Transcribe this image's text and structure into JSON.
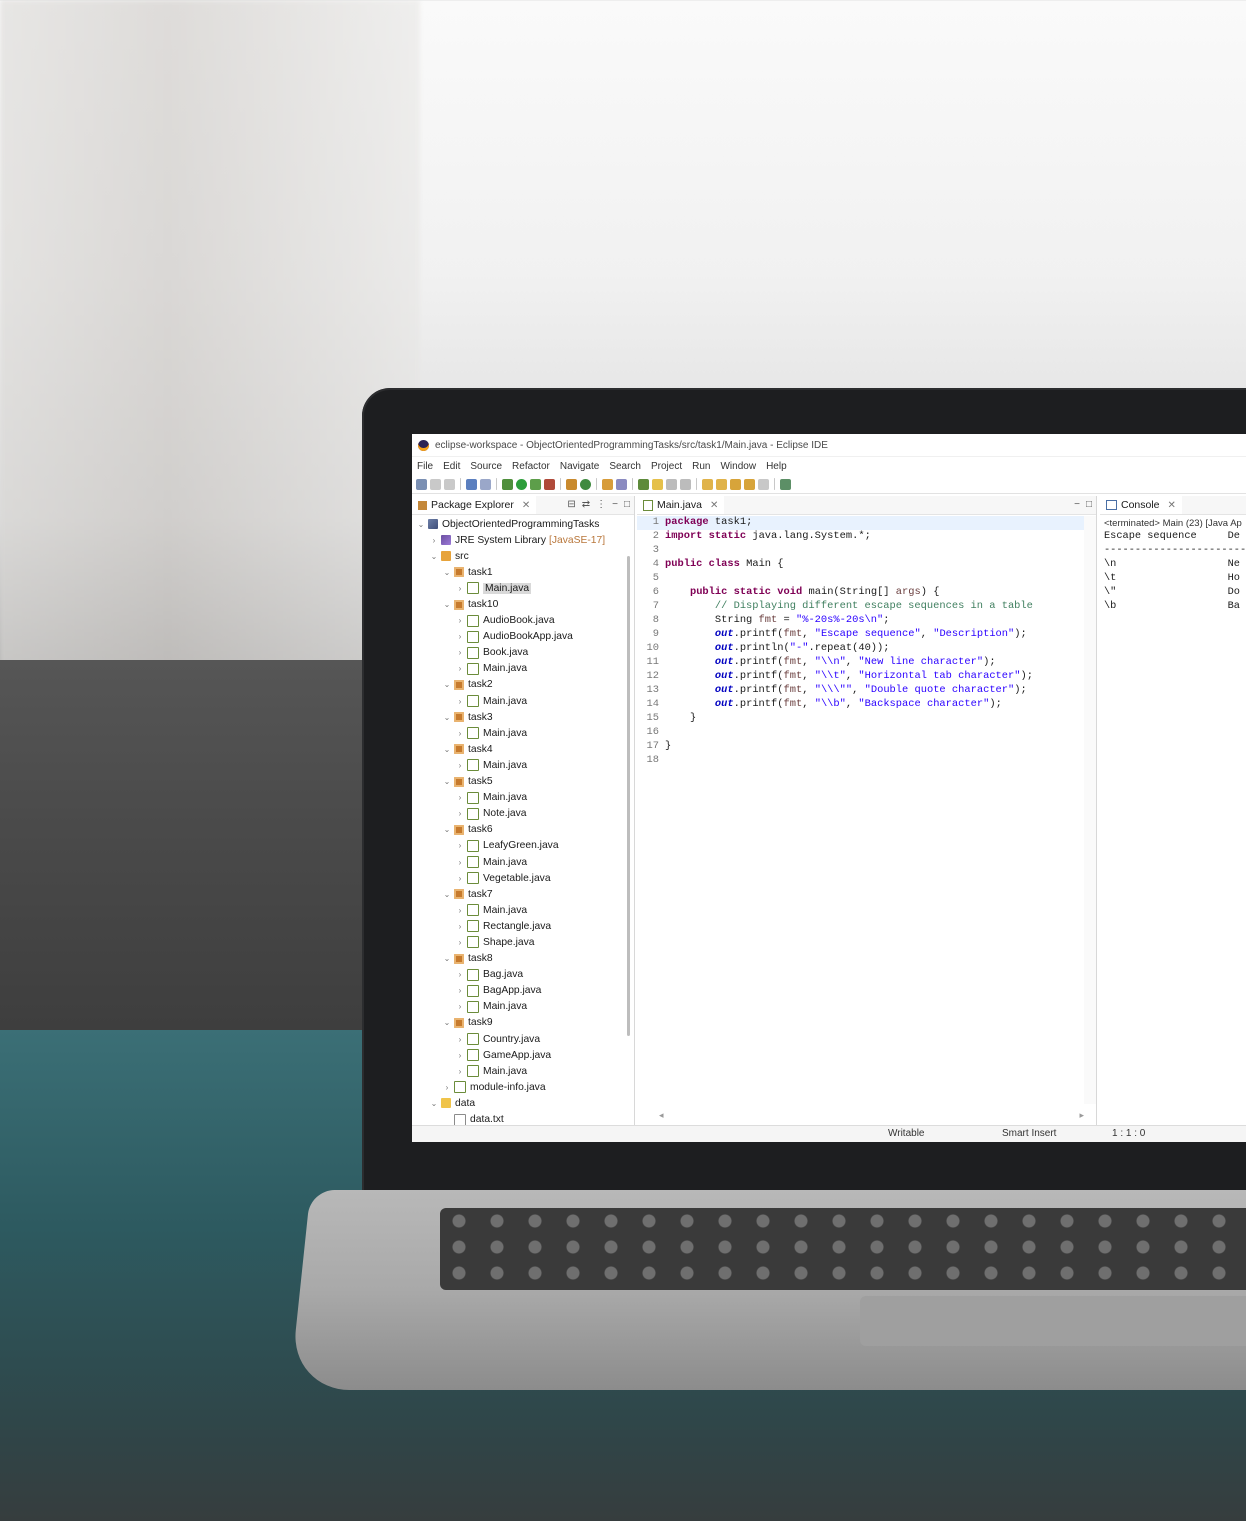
{
  "window": {
    "title": "eclipse-workspace - ObjectOrientedProgrammingTasks/src/task1/Main.java - Eclipse IDE"
  },
  "menu": [
    "File",
    "Edit",
    "Source",
    "Refactor",
    "Navigate",
    "Search",
    "Project",
    "Run",
    "Window",
    "Help"
  ],
  "explorer": {
    "tab_label": "Package Explorer",
    "tree": [
      {
        "depth": 0,
        "twisty": "v",
        "icon": "project",
        "label": "ObjectOrientedProgrammingTasks"
      },
      {
        "depth": 1,
        "twisty": ">",
        "icon": "library",
        "label": "JRE System Library",
        "tag": "[JavaSE-17]"
      },
      {
        "depth": 1,
        "twisty": "v",
        "icon": "source-folder",
        "label": "src"
      },
      {
        "depth": 2,
        "twisty": "v",
        "icon": "package",
        "label": "task1"
      },
      {
        "depth": 3,
        "twisty": ">",
        "icon": "java-file",
        "label": "Main.java",
        "selected": true
      },
      {
        "depth": 2,
        "twisty": "v",
        "icon": "package",
        "label": "task10"
      },
      {
        "depth": 3,
        "twisty": ">",
        "icon": "java-file",
        "label": "AudioBook.java"
      },
      {
        "depth": 3,
        "twisty": ">",
        "icon": "java-file",
        "label": "AudioBookApp.java"
      },
      {
        "depth": 3,
        "twisty": ">",
        "icon": "java-file",
        "label": "Book.java"
      },
      {
        "depth": 3,
        "twisty": ">",
        "icon": "java-file",
        "label": "Main.java"
      },
      {
        "depth": 2,
        "twisty": "v",
        "icon": "package",
        "label": "task2"
      },
      {
        "depth": 3,
        "twisty": ">",
        "icon": "java-file",
        "label": "Main.java"
      },
      {
        "depth": 2,
        "twisty": "v",
        "icon": "package",
        "label": "task3"
      },
      {
        "depth": 3,
        "twisty": ">",
        "icon": "java-file",
        "label": "Main.java"
      },
      {
        "depth": 2,
        "twisty": "v",
        "icon": "package",
        "label": "task4"
      },
      {
        "depth": 3,
        "twisty": ">",
        "icon": "java-file",
        "label": "Main.java"
      },
      {
        "depth": 2,
        "twisty": "v",
        "icon": "package",
        "label": "task5"
      },
      {
        "depth": 3,
        "twisty": ">",
        "icon": "java-file",
        "label": "Main.java"
      },
      {
        "depth": 3,
        "twisty": ">",
        "icon": "java-file",
        "label": "Note.java"
      },
      {
        "depth": 2,
        "twisty": "v",
        "icon": "package",
        "label": "task6"
      },
      {
        "depth": 3,
        "twisty": ">",
        "icon": "java-file",
        "label": "LeafyGreen.java"
      },
      {
        "depth": 3,
        "twisty": ">",
        "icon": "java-file",
        "label": "Main.java"
      },
      {
        "depth": 3,
        "twisty": ">",
        "icon": "java-file",
        "label": "Vegetable.java"
      },
      {
        "depth": 2,
        "twisty": "v",
        "icon": "package",
        "label": "task7"
      },
      {
        "depth": 3,
        "twisty": ">",
        "icon": "java-file",
        "label": "Main.java"
      },
      {
        "depth": 3,
        "twisty": ">",
        "icon": "java-file",
        "label": "Rectangle.java"
      },
      {
        "depth": 3,
        "twisty": ">",
        "icon": "java-file",
        "label": "Shape.java"
      },
      {
        "depth": 2,
        "twisty": "v",
        "icon": "package",
        "label": "task8"
      },
      {
        "depth": 3,
        "twisty": ">",
        "icon": "java-file",
        "label": "Bag.java"
      },
      {
        "depth": 3,
        "twisty": ">",
        "icon": "java-file",
        "label": "BagApp.java"
      },
      {
        "depth": 3,
        "twisty": ">",
        "icon": "java-file",
        "label": "Main.java"
      },
      {
        "depth": 2,
        "twisty": "v",
        "icon": "package",
        "label": "task9"
      },
      {
        "depth": 3,
        "twisty": ">",
        "icon": "java-file",
        "label": "Country.java"
      },
      {
        "depth": 3,
        "twisty": ">",
        "icon": "java-file",
        "label": "GameApp.java"
      },
      {
        "depth": 3,
        "twisty": ">",
        "icon": "java-file",
        "label": "Main.java"
      },
      {
        "depth": 2,
        "twisty": ">",
        "icon": "java-file",
        "label": "module-info.java"
      },
      {
        "depth": 1,
        "twisty": "v",
        "icon": "folder",
        "label": "data"
      },
      {
        "depth": 2,
        "twisty": "",
        "icon": "text-file",
        "label": "data.txt"
      }
    ]
  },
  "editor": {
    "tab_label": "Main.java",
    "lines": [
      [
        {
          "t": "kw",
          "s": "package"
        },
        {
          "t": "",
          "s": " task1;"
        }
      ],
      [
        {
          "t": "kw",
          "s": "import"
        },
        {
          "t": "",
          "s": " "
        },
        {
          "t": "kw",
          "s": "static"
        },
        {
          "t": "",
          "s": " java.lang.System.*;"
        }
      ],
      [],
      [
        {
          "t": "kw",
          "s": "public"
        },
        {
          "t": "",
          "s": " "
        },
        {
          "t": "kw",
          "s": "class"
        },
        {
          "t": "",
          "s": " Main {"
        }
      ],
      [],
      [
        {
          "t": "",
          "s": "    "
        },
        {
          "t": "kw",
          "s": "public"
        },
        {
          "t": "",
          "s": " "
        },
        {
          "t": "kw",
          "s": "static"
        },
        {
          "t": "",
          "s": " "
        },
        {
          "t": "kw",
          "s": "void"
        },
        {
          "t": "",
          "s": " main(String[] "
        },
        {
          "t": "arg",
          "s": "args"
        },
        {
          "t": "",
          "s": ") {"
        }
      ],
      [
        {
          "t": "cmt",
          "s": "        // Displaying different escape sequences in a table"
        }
      ],
      [
        {
          "t": "",
          "s": "        String "
        },
        {
          "t": "var",
          "s": "fmt"
        },
        {
          "t": "",
          "s": " = "
        },
        {
          "t": "str",
          "s": "\"%-20s%-20s\\n\""
        },
        {
          "t": "",
          "s": ";"
        }
      ],
      [
        {
          "t": "",
          "s": "        "
        },
        {
          "t": "fld",
          "s": "out"
        },
        {
          "t": "",
          "s": ".printf("
        },
        {
          "t": "var",
          "s": "fmt"
        },
        {
          "t": "",
          "s": ", "
        },
        {
          "t": "str",
          "s": "\"Escape sequence\""
        },
        {
          "t": "",
          "s": ", "
        },
        {
          "t": "str",
          "s": "\"Description\""
        },
        {
          "t": "",
          "s": ");"
        }
      ],
      [
        {
          "t": "",
          "s": "        "
        },
        {
          "t": "fld",
          "s": "out"
        },
        {
          "t": "",
          "s": ".println("
        },
        {
          "t": "str",
          "s": "\"-\""
        },
        {
          "t": "",
          "s": ".repeat(40));"
        }
      ],
      [
        {
          "t": "",
          "s": "        "
        },
        {
          "t": "fld",
          "s": "out"
        },
        {
          "t": "",
          "s": ".printf("
        },
        {
          "t": "var",
          "s": "fmt"
        },
        {
          "t": "",
          "s": ", "
        },
        {
          "t": "str",
          "s": "\"\\\\n\""
        },
        {
          "t": "",
          "s": ", "
        },
        {
          "t": "str",
          "s": "\"New line character\""
        },
        {
          "t": "",
          "s": ");"
        }
      ],
      [
        {
          "t": "",
          "s": "        "
        },
        {
          "t": "fld",
          "s": "out"
        },
        {
          "t": "",
          "s": ".printf("
        },
        {
          "t": "var",
          "s": "fmt"
        },
        {
          "t": "",
          "s": ", "
        },
        {
          "t": "str",
          "s": "\"\\\\t\""
        },
        {
          "t": "",
          "s": ", "
        },
        {
          "t": "str",
          "s": "\"Horizontal tab character\""
        },
        {
          "t": "",
          "s": ");"
        }
      ],
      [
        {
          "t": "",
          "s": "        "
        },
        {
          "t": "fld",
          "s": "out"
        },
        {
          "t": "",
          "s": ".printf("
        },
        {
          "t": "var",
          "s": "fmt"
        },
        {
          "t": "",
          "s": ", "
        },
        {
          "t": "str",
          "s": "\"\\\\\\\"\""
        },
        {
          "t": "",
          "s": ", "
        },
        {
          "t": "str",
          "s": "\"Double quote character\""
        },
        {
          "t": "",
          "s": ");"
        }
      ],
      [
        {
          "t": "",
          "s": "        "
        },
        {
          "t": "fld",
          "s": "out"
        },
        {
          "t": "",
          "s": ".printf("
        },
        {
          "t": "var",
          "s": "fmt"
        },
        {
          "t": "",
          "s": ", "
        },
        {
          "t": "str",
          "s": "\"\\\\b\""
        },
        {
          "t": "",
          "s": ", "
        },
        {
          "t": "str",
          "s": "\"Backspace character\""
        },
        {
          "t": "",
          "s": ");"
        }
      ],
      [
        {
          "t": "",
          "s": "    }"
        }
      ],
      [],
      [
        {
          "t": "",
          "s": "}"
        }
      ],
      []
    ]
  },
  "console": {
    "tab_label": "Console",
    "terminated": "<terminated> Main (23) [Java Ap",
    "lines": [
      "Escape sequence     De",
      "-----------------------",
      "\\n                  Ne",
      "\\t                  Ho",
      "\\\"                  Do",
      "\\b                  Ba"
    ]
  },
  "status": {
    "mode": "Writable",
    "insert": "Smart Insert",
    "position": "1 : 1 : 0"
  }
}
